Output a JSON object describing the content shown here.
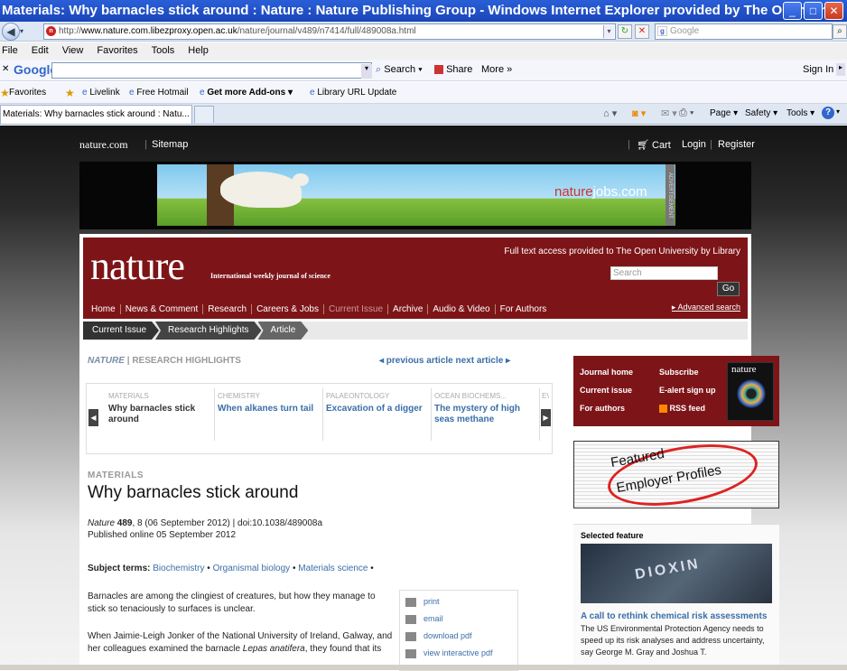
{
  "window": {
    "title": "Materials: Why barnacles stick around : Nature : Nature Publishing Group - Windows Internet Explorer provided by The Open Un...",
    "btn_min": "_",
    "btn_max": "□",
    "btn_close": "✕"
  },
  "address": {
    "url_prefix": "http://",
    "url_domain": "www.nature.com.libezproxy.open.ac.uk",
    "url_path": "/nature/journal/v489/n7414/full/489008a.html",
    "search_placeholder": "Google"
  },
  "menu": [
    "File",
    "Edit",
    "View",
    "Favorites",
    "Tools",
    "Help"
  ],
  "google_toolbar": {
    "logo": "Google",
    "search": "Search",
    "share": "Share",
    "more": "More »",
    "signin": "Sign In"
  },
  "favorites_bar": {
    "favorites": "Favorites",
    "items": [
      "Livelink",
      "Free Hotmail",
      "Get more Add-ons",
      "Library URL Update"
    ]
  },
  "tab": {
    "label": "Materials: Why barnacles stick around : Natu..."
  },
  "ie_cmd": {
    "page": "Page",
    "safety": "Safety",
    "tools": "Tools"
  },
  "site": {
    "brand": "nature.com",
    "sitemap": "Sitemap",
    "cart": "Cart",
    "login": "Login",
    "register": "Register"
  },
  "banner": {
    "ad_label": "ADVERTISEMENT",
    "jobs_a": "nature",
    "jobs_b": "jobs.com"
  },
  "header": {
    "logo": "nature",
    "tagline": "International weekly journal of science",
    "access": "Full text access provided to The Open University by Library",
    "search_placeholder": "Search",
    "go": "Go",
    "advanced": "Advanced search"
  },
  "nav": [
    "Home",
    "News & Comment",
    "Research",
    "Careers & Jobs",
    "Current Issue",
    "Archive",
    "Audio & Video",
    "For Authors"
  ],
  "breadcrumb": [
    "Current Issue",
    "Research Highlights",
    "Article"
  ],
  "section": {
    "journal": "NATURE",
    "sep": "|",
    "name": "RESEARCH HIGHLIGHTS",
    "prev": "◂ previous article",
    "next": "next article ▸"
  },
  "carousel": [
    {
      "cat": "MATERIALS",
      "title": "Why barnacles stick around"
    },
    {
      "cat": "CHEMISTRY",
      "title": "When alkanes turn tail"
    },
    {
      "cat": "PALAEONTOLOGY",
      "title": "Excavation of a digger"
    },
    {
      "cat": "OCEAN BIOCHEMS...",
      "title": "The mystery of high seas methane"
    },
    {
      "cat": "EV",
      "title": ""
    }
  ],
  "article": {
    "category": "MATERIALS",
    "title": "Why barnacles stick around",
    "journal": "Nature",
    "volume": "489",
    "cite_rest": ", 8 (06 September 2012)  |  doi:10.1038/489008a",
    "published": "Published online  05 September 2012",
    "subject_label": "Subject terms:",
    "subjects": [
      "Biochemistry",
      "Organismal biology",
      "Materials science"
    ],
    "para1": "Barnacles are among the clingiest of creatures, but how they manage to stick so tenaciously to surfaces is unclear.",
    "para2a": "When Jaimie-Leigh Jonker of the National University of Ireland, Galway, and her colleagues examined the barnacle ",
    "para2i": "Lepas anatifera",
    "para2b": ", they found that its"
  },
  "tools": [
    "print",
    "email",
    "download pdf",
    "view interactive pdf"
  ],
  "journal_box": {
    "home": "Journal home",
    "current": "Current issue",
    "authors": "For authors",
    "subscribe": "Subscribe",
    "ealert": "E-alert sign up",
    "rss": "RSS feed",
    "cover_title": "nature"
  },
  "featured_employers": {
    "line1": "Featured",
    "line2": "Employer Profiles"
  },
  "selected_feature": {
    "heading": "Selected feature",
    "img_text": "DIOXIN",
    "title": "A call to rethink chemical risk assessments",
    "desc": "The US Environmental Protection Agency needs to speed up its risk analyses and address uncertainty, say George M. Gray and Joshua T."
  },
  "colors": {
    "nature_red": "#7d1518",
    "link_blue": "#3b6ea8",
    "ie_blue": "#1a45b8"
  }
}
